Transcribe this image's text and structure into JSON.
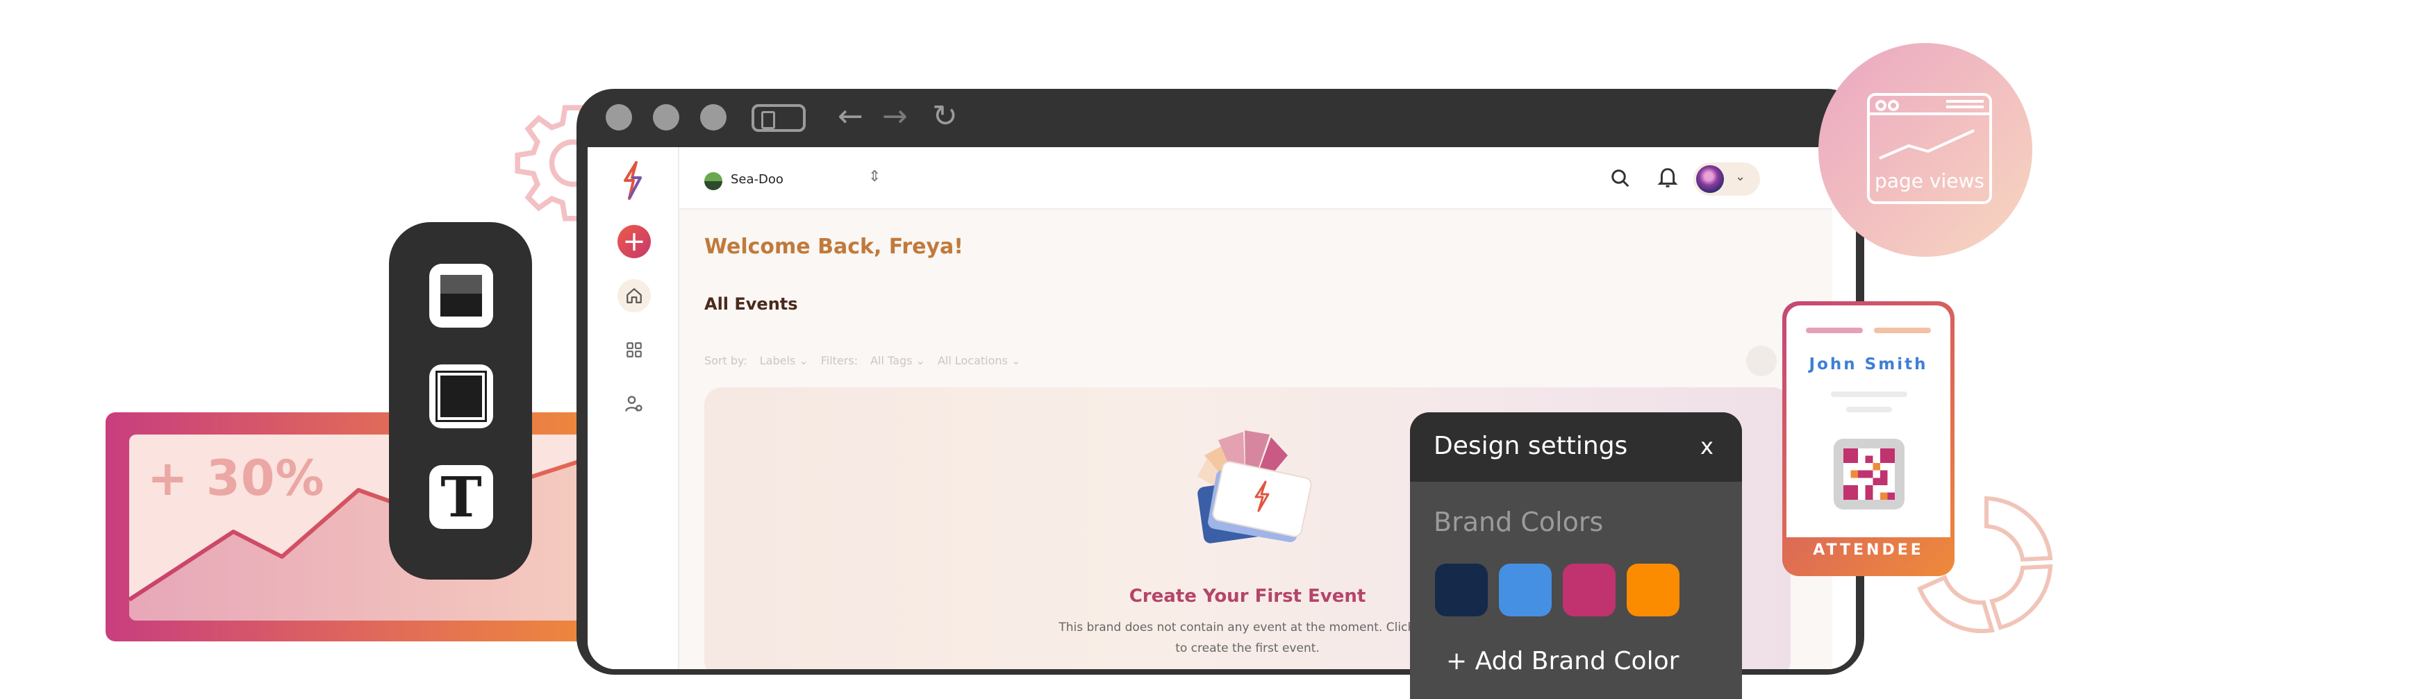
{
  "analytics": {
    "growth_label": "+ 30%",
    "colors": {
      "start": "#c83e7e",
      "end": "#ef8a3a"
    }
  },
  "tools": [
    {
      "name": "fill-tool",
      "icon": "fill-icon"
    },
    {
      "name": "border-tool",
      "icon": "border-icon"
    },
    {
      "name": "text-tool",
      "icon": "text-icon",
      "glyph": "T"
    }
  ],
  "browser": {
    "brand": {
      "name": "Sea-Doo"
    },
    "welcome": "Welcome Back, Freya!",
    "section_title": "All Events",
    "filters": {
      "sort_by_label": "Sort by:",
      "sort_by_value": "Labels ⌄",
      "filter_label": "Filters:",
      "tags_value": "All Tags ⌄",
      "locations_value": "All Locations ⌄"
    },
    "empty_state": {
      "title": "Create Your First Event",
      "line1": "This brand does not contain any event at the moment. Click bel",
      "line2": "to create the first event."
    }
  },
  "design_settings": {
    "title": "Design settings",
    "close_label": "x",
    "section_label": "Brand Colors",
    "swatches": [
      "#152a4a",
      "#4590e3",
      "#c0336f",
      "#fb8c00"
    ],
    "add_label": "+ Add Brand Color"
  },
  "page_views": {
    "label": "page views"
  },
  "badge": {
    "name": "John Smith",
    "role": "ATTENDEE"
  }
}
